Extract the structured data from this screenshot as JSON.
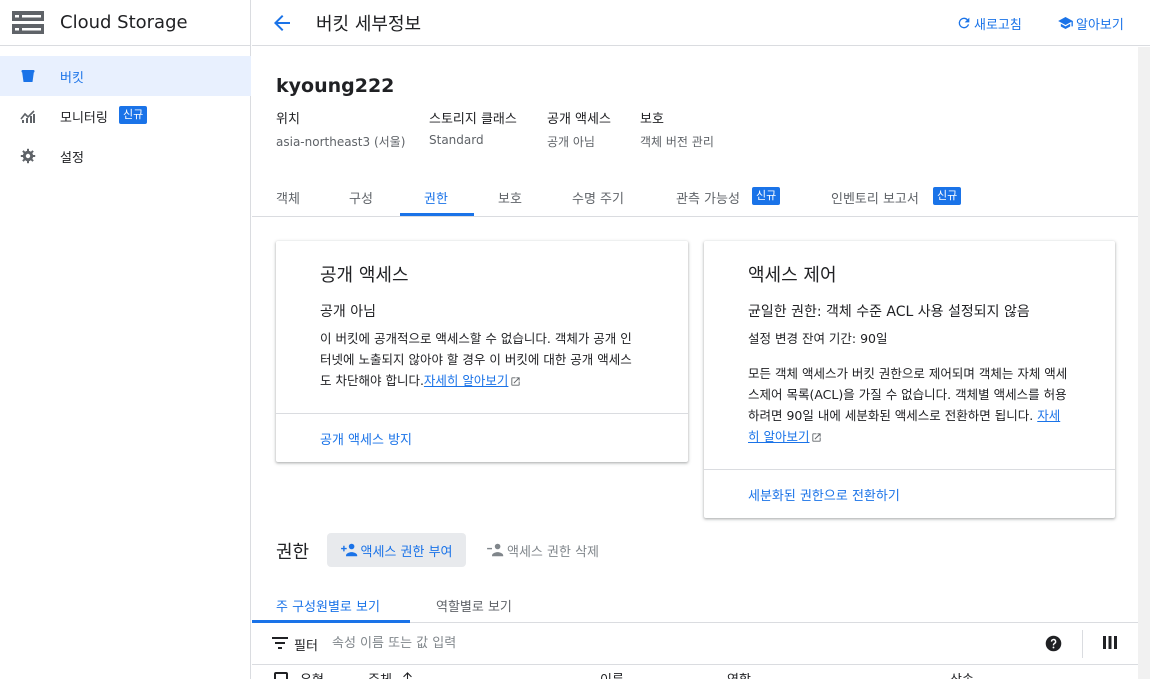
{
  "app": {
    "title": "Cloud Storage"
  },
  "sidebar": {
    "items": [
      {
        "label": "버킷",
        "icon": "bucket-icon",
        "active": true
      },
      {
        "label": "모니터링",
        "icon": "monitoring-icon",
        "badge": "신규"
      },
      {
        "label": "설정",
        "icon": "gear-icon"
      }
    ]
  },
  "header": {
    "title": "버킷 세부정보",
    "refresh_label": "새로고침",
    "learn_label": "알아보기"
  },
  "bucket": {
    "name": "kyoung222",
    "meta": [
      {
        "label": "위치",
        "value": "asia-northeast3 (서울)"
      },
      {
        "label": "스토리지 클래스",
        "value": "Standard"
      },
      {
        "label": "공개 액세스",
        "value": "공개 아님"
      },
      {
        "label": "보호",
        "value": "객체 버전 관리"
      }
    ]
  },
  "tabs": [
    {
      "label": "객체"
    },
    {
      "label": "구성"
    },
    {
      "label": "권한",
      "active": true
    },
    {
      "label": "보호"
    },
    {
      "label": "수명 주기"
    },
    {
      "label": "관측 가능성",
      "badge": "신규"
    },
    {
      "label": "인벤토리 보고서",
      "badge": "신규"
    }
  ],
  "public_access_card": {
    "title": "공개 액세스",
    "status": "공개 아님",
    "description_lines": [
      "이 버킷에 공개적으로 액세스할 수 없습니다. 객체가 공개 인",
      "터넷에 노출되지 않아야 할 경우 이 버킷에 대한 공개 액세스",
      "도 차단해야 합니다."
    ],
    "learn_more": "자세히 알아보기",
    "action": "공개 액세스 방지"
  },
  "access_control_card": {
    "title": "액세스 제어",
    "uniform_label": "균일한 권한: 객체 수준 ACL 사용 설정되지 않음",
    "grace_period": "설정 변경 잔여 기간: 90일",
    "description_lines": [
      "모든 객체 액세스가 버킷 권한으로 제어되며 객체는 자체 액세",
      "스제어 목록(ACL)을 가질 수 없습니다. 객체별 액세스를 허용",
      "하려면 90일 내에 세분화된 액세스로 전환하면 됩니다."
    ],
    "learn_more_a": "자세",
    "learn_more_b": "히 알아보기",
    "action": "세분화된 권한으로 전환하기"
  },
  "permissions": {
    "title": "권한",
    "grant_label": "액세스 권한 부여",
    "remove_label": "액세스 권한 삭제",
    "subtabs": [
      {
        "label": "주 구성원별로 보기",
        "active": true
      },
      {
        "label": "역할별로 보기"
      }
    ],
    "filter_label": "필터",
    "filter_placeholder": "속성 이름 또는 값 입력",
    "columns": [
      "유형",
      "주체",
      "이름",
      "역할",
      "상속"
    ]
  },
  "colors": {
    "accent": "#1a73e8",
    "border": "#dadce0",
    "active_bg": "#e8f0fe"
  }
}
